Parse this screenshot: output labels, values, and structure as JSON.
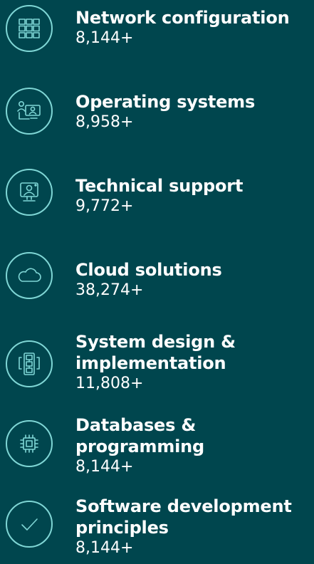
{
  "items": [
    {
      "title_lines": [
        "Network configuration"
      ],
      "count": "8,144+",
      "icon": "grid-icon"
    },
    {
      "title_lines": [
        "Operating systems"
      ],
      "count": "8,958+",
      "icon": "users-monitor-icon"
    },
    {
      "title_lines": [
        "Technical support"
      ],
      "count": "9,772+",
      "icon": "support-monitor-icon"
    },
    {
      "title_lines": [
        "Cloud solutions"
      ],
      "count": "38,274+",
      "icon": "cloud-icon"
    },
    {
      "title_lines": [
        "System design &",
        "implementation"
      ],
      "count": "11,808+",
      "icon": "flowchart-icon"
    },
    {
      "title_lines": [
        "Databases &",
        "programming"
      ],
      "count": "8,144+",
      "icon": "chip-icon"
    },
    {
      "title_lines": [
        "Software development",
        "principles"
      ],
      "count": "8,144+",
      "icon": "checkmark-icon"
    }
  ],
  "colors": {
    "background": "#00464e",
    "accent": "#7fd6d5",
    "text": "#ffffff"
  }
}
